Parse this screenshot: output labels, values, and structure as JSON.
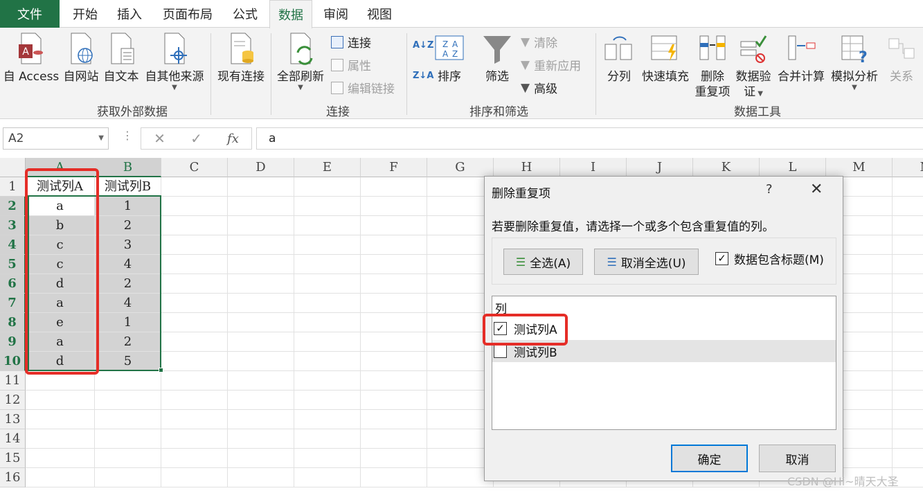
{
  "tabs": {
    "file": "文件",
    "items": [
      "开始",
      "插入",
      "页面布局",
      "公式",
      "数据",
      "审阅",
      "视图"
    ],
    "active": "数据"
  },
  "ribbon": {
    "get_external": {
      "buttons": [
        "自 Access",
        "自网站",
        "自文本",
        "自其他来源",
        "现有连接"
      ],
      "group_label": "获取外部数据"
    },
    "connections": {
      "refresh_all": "全部刷新",
      "connections": "连接",
      "properties": "属性",
      "edit_links": "编辑链接",
      "group_label": "连接"
    },
    "sort_filter": {
      "sort": "排序",
      "filter": "筛选",
      "clear": "清除",
      "reapply": "重新应用",
      "advanced": "高级",
      "group_label": "排序和筛选"
    },
    "data_tools": {
      "text_to_columns": "分列",
      "flash_fill": "快速填充",
      "remove_duplicates_1": "删除",
      "remove_duplicates_2": "重复项",
      "validation_1": "数据验",
      "validation_2": "证",
      "consolidate": "合并计算",
      "what_if": "模拟分析",
      "relationships": "关系",
      "group_label": "数据工具"
    }
  },
  "formula_bar": {
    "name_box": "A2",
    "formula": "a"
  },
  "sheet": {
    "columns": [
      "A",
      "B",
      "C",
      "D",
      "E",
      "F",
      "G",
      "H",
      "I",
      "J",
      "K",
      "L",
      "M",
      "N"
    ],
    "row_numbers": [
      "1",
      "2",
      "3",
      "4",
      "5",
      "6",
      "7",
      "8",
      "9",
      "10",
      "11",
      "12",
      "13",
      "14",
      "15",
      "16"
    ],
    "header_row": [
      "测试列A",
      "测试列B"
    ],
    "col_a": [
      "a",
      "b",
      "c",
      "c",
      "d",
      "a",
      "e",
      "a",
      "d"
    ],
    "col_b": [
      "1",
      "2",
      "3",
      "4",
      "2",
      "4",
      "1",
      "2",
      "5"
    ]
  },
  "dialog": {
    "title": "删除重复项",
    "help": "?",
    "close": "✕",
    "instruction": "若要删除重复值，请选择一个或多个包含重复值的列。",
    "select_all": "全选(A)",
    "unselect_all": "取消全选(U)",
    "has_headers": "数据包含标题(M)",
    "has_headers_checked": true,
    "columns_header": "列",
    "column_items": [
      {
        "label": "测试列A",
        "checked": true
      },
      {
        "label": "测试列B",
        "checked": false
      }
    ],
    "ok": "确定",
    "cancel": "取消"
  },
  "watermark": "CSDN @Hi~晴天大圣",
  "colors": {
    "excel_green": "#217346",
    "highlight_red": "#e52d27",
    "ok_border": "#0078d7"
  }
}
